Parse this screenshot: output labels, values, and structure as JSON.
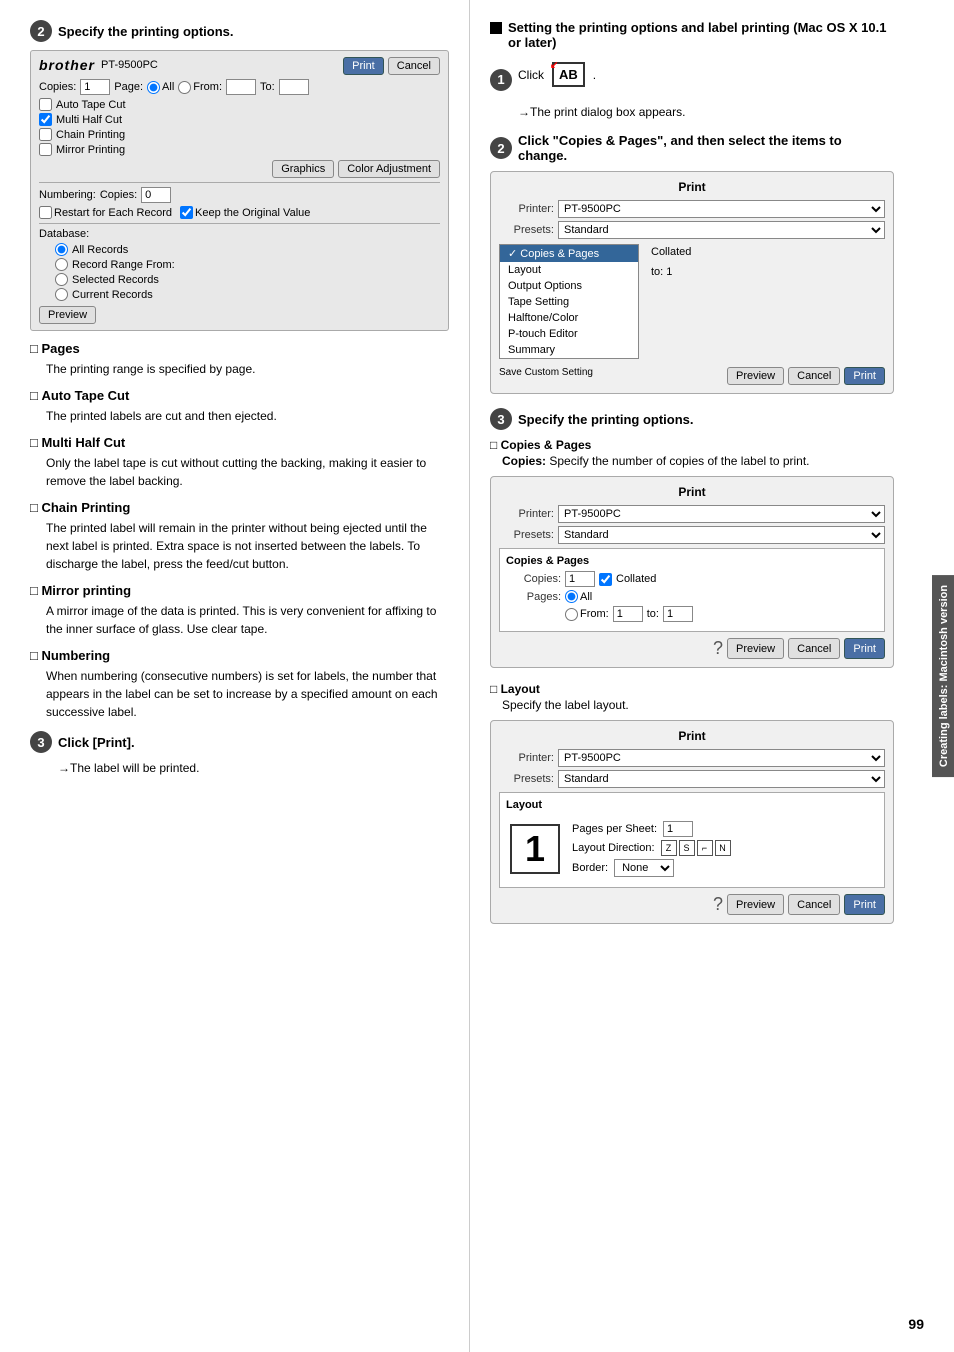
{
  "page_number": "99",
  "side_tab": "Creating labels: Macintosh version",
  "left_col": {
    "step2_title": "Specify the printing options.",
    "left_dialog": {
      "printer_name": "PT-9500PC",
      "print_btn": "Print",
      "cancel_btn": "Cancel",
      "copies_label": "Copies:",
      "copies_value": "1",
      "page_label": "Page:",
      "all_option": "All",
      "from_option": "From:",
      "to_label": "To:",
      "checkboxes": [
        {
          "label": "Auto Tape Cut",
          "checked": false
        },
        {
          "label": "Multi Half Cut",
          "checked": true
        },
        {
          "label": "Chain Printing",
          "checked": false
        },
        {
          "label": "Mirror Printing",
          "checked": false
        }
      ],
      "graphics_btn": "Graphics",
      "color_btn": "Color Adjustment",
      "numbering_label": "Numbering:",
      "copies_n_label": "Copies:",
      "copies_n_value": "0",
      "restart_label": "Restart for Each Record",
      "keep_label": "Keep the Original Value",
      "database_label": "Database:",
      "db_options": [
        {
          "label": "All Records",
          "checked": true
        },
        {
          "label": "Record Range From:",
          "checked": false
        },
        {
          "label": "Selected Records",
          "checked": false
        },
        {
          "label": "Current Records",
          "checked": false
        }
      ],
      "preview_btn": "Preview"
    },
    "sections": [
      {
        "title": "Pages",
        "body": "The printing range is specified by page."
      },
      {
        "title": "Auto Tape Cut",
        "body": "The printed labels are cut and then ejected."
      },
      {
        "title": "Multi Half Cut",
        "body": "Only the label tape is cut without cutting the backing, making it easier to remove the label backing."
      },
      {
        "title": "Chain Printing",
        "body": "The printed label will remain in the printer without being ejected until the next label is printed. Extra space is not inserted between the labels. To discharge the label, press the feed/cut button."
      },
      {
        "title": "Mirror printing",
        "body": "A mirror image of the data is printed. This is very convenient for affixing to the inner surface of glass. Use clear tape."
      },
      {
        "title": "Numbering",
        "body": "When numbering (consecutive numbers) is set for labels, the number that appears in the label can be set to increase by a specified amount on each successive label."
      }
    ],
    "step3_title": "Click [Print].",
    "step3_body": "→The label will be printed."
  },
  "right_col": {
    "heading_square": "■",
    "heading": "Setting the printing options and label printing (Mac OS X 10.1 or later)",
    "step1": {
      "click_text": "Click",
      "icon_text": "AB",
      "period": ".",
      "arrow_text": "→The print dialog box appears."
    },
    "step2": {
      "title": "Click \"Copies & Pages\", and then select the items to change.",
      "dialog1": {
        "title": "Print",
        "printer_label": "Printer:",
        "printer_value": "PT-9500PC",
        "presets_label": "Presets:",
        "presets_value": "Standard",
        "menu_items": [
          {
            "label": "✓ Copies & Pages",
            "selected": true
          },
          {
            "label": "Layout",
            "selected": false
          },
          {
            "label": "Output Options",
            "selected": false
          },
          {
            "label": "Tape Setting",
            "selected": false
          },
          {
            "label": "Halftone/Color",
            "selected": false
          },
          {
            "label": "P-touch Editor",
            "selected": false
          },
          {
            "label": "Summary",
            "selected": false
          }
        ],
        "right_text": "Collated",
        "to_label": "to:",
        "to_value": "1",
        "save_custom": "Save Custom Setting",
        "preview_btn": "Preview",
        "cancel_btn": "Cancel",
        "print_btn": "Print"
      }
    },
    "step3": {
      "title": "Specify the printing options.",
      "copies_pages_section": {
        "title": "Copies & Pages",
        "copies_bold": "Copies:",
        "copies_body": "Specify the number of copies of the label to print.",
        "dialog": {
          "title": "Print",
          "printer_label": "Printer:",
          "printer_value": "PT-9500PC",
          "presets_label": "Presets:",
          "presets_value": "Standard",
          "section_label": "Copies & Pages",
          "copies_label": "Copies:",
          "copies_value": "1",
          "collated_label": "Collated",
          "pages_label": "Pages:",
          "all_option": "All",
          "from_option": "From:",
          "from_value": "1",
          "to_label": "to:",
          "to_value": "1",
          "preview_btn": "Preview",
          "cancel_btn": "Cancel",
          "print_btn": "Print"
        }
      },
      "layout_section": {
        "title": "Layout",
        "body": "Specify the label layout.",
        "dialog": {
          "title": "Print",
          "printer_label": "Printer:",
          "printer_value": "PT-9500PC",
          "presets_label": "Presets:",
          "presets_value": "Standard",
          "section_label": "Layout",
          "pages_per_sheet_label": "Pages per Sheet:",
          "pages_per_sheet_value": "1",
          "layout_direction_label": "Layout Direction:",
          "border_label": "Border:",
          "border_value": "None",
          "preview_btn": "Preview",
          "cancel_btn": "Cancel",
          "print_btn": "Print"
        }
      }
    }
  }
}
